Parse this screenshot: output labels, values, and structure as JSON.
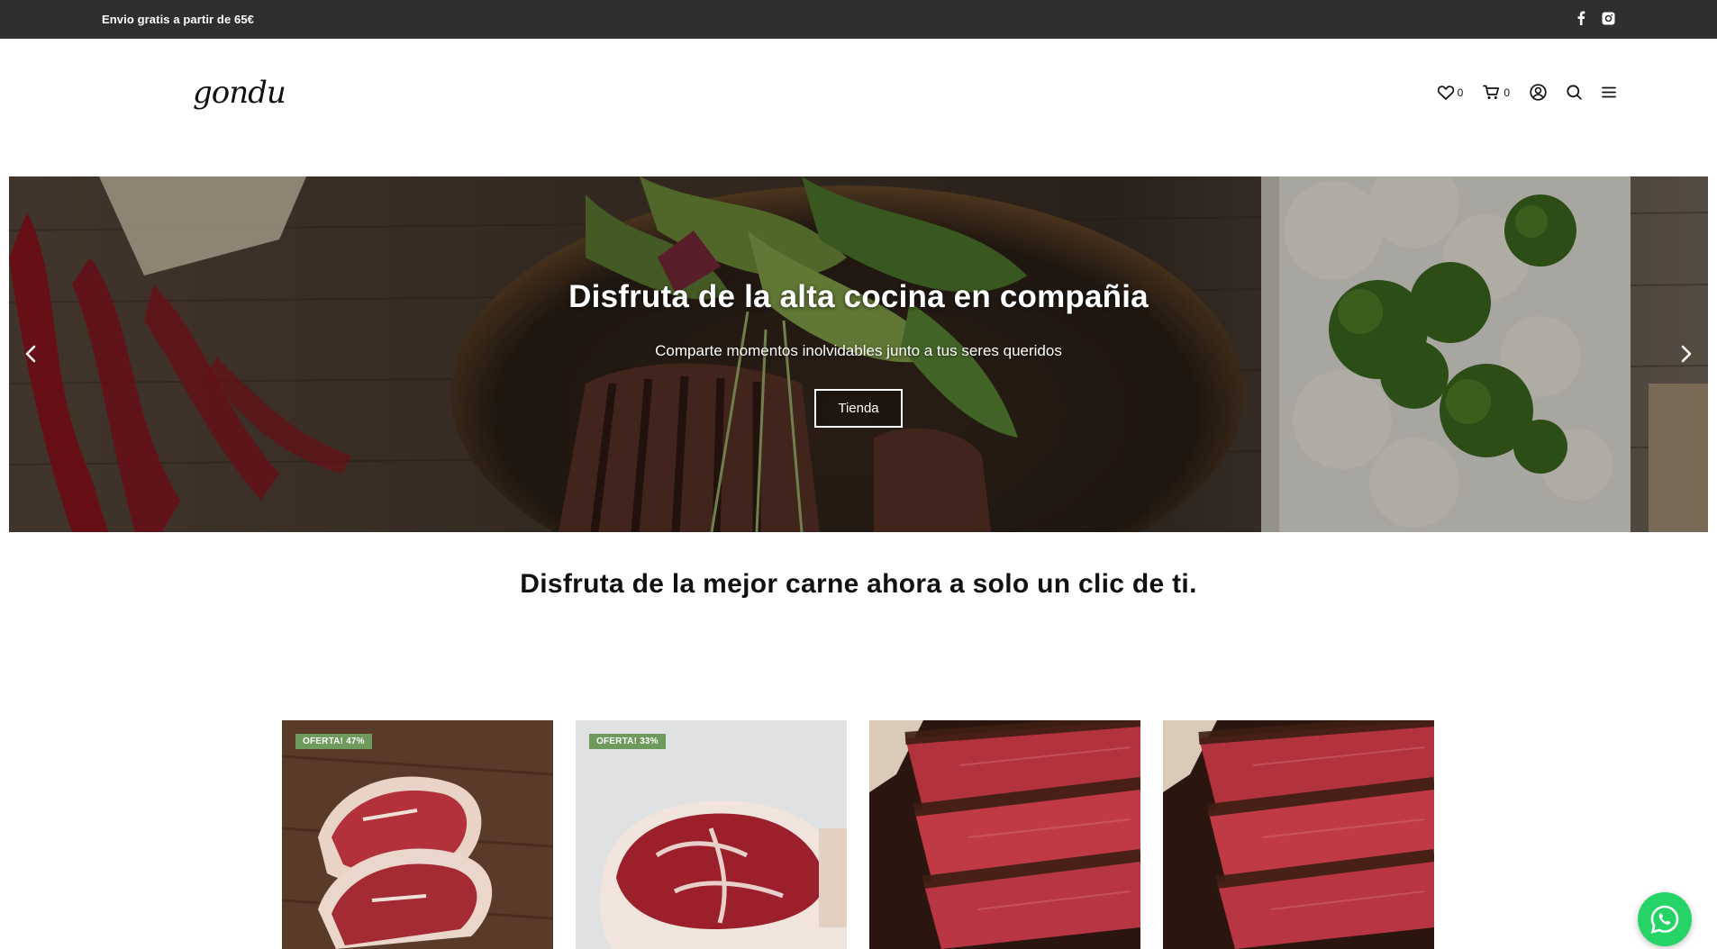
{
  "topbar": {
    "promo_text": "Envio gratis a partir de 65€",
    "social": [
      {
        "icon": "facebook-icon"
      },
      {
        "icon": "instagram-icon"
      }
    ]
  },
  "header": {
    "logo_text": "gondu",
    "wishlist_count": "0",
    "cart_count": "0",
    "icons": [
      "heart-icon",
      "cart-icon",
      "user-icon",
      "search-icon",
      "menu-icon"
    ]
  },
  "hero": {
    "title": "Disfruta de la alta cocina en compañia",
    "subtitle": "Comparte momentos inolvidables junto a tus seres queridos",
    "button_label": "Tienda"
  },
  "main": {
    "tagline": "Disfruta de la mejor carne ahora a solo un clic de ti."
  },
  "products": [
    {
      "badge": "OFERTA! 47%",
      "image": "raw-steaks-on-wood"
    },
    {
      "badge": "OFERTA! 33%",
      "image": "raw-ribeye-on-grey"
    },
    {
      "badge": "",
      "image": "grilled-sliced-steak"
    },
    {
      "badge": "",
      "image": "grilled-sliced-steak"
    }
  ],
  "colors": {
    "topbar_bg": "#2f2f2f",
    "badge_bg": "#6e9a5d",
    "whatsapp": "#25d366"
  }
}
